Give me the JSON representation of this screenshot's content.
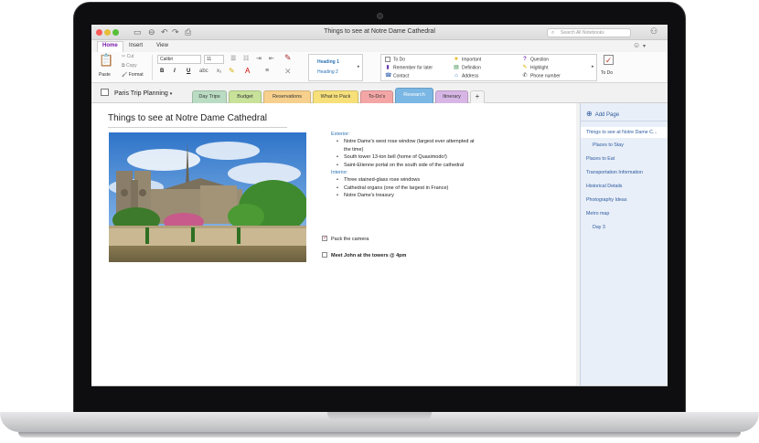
{
  "window": {
    "title": "Things to see at Notre Dame Cathedral",
    "search_placeholder": "Search All Notebooks"
  },
  "ribbon_tabs": [
    "Home",
    "Insert",
    "View"
  ],
  "ribbon": {
    "paste": "Paste",
    "cut": "Cut",
    "copy": "Copy",
    "format": "Format",
    "font": "Calibri",
    "size": "11",
    "bold": "B",
    "italic": "I",
    "underline": "U",
    "styles": [
      "Heading 1",
      "Heading 2"
    ],
    "tags": {
      "col1": [
        "To Do",
        "Remember for later",
        "Contact"
      ],
      "col2": [
        "Important",
        "Definition",
        "Address"
      ],
      "col3": [
        "Question",
        "Highlight",
        "Phone number"
      ]
    },
    "todo_button": "To Do"
  },
  "notebook": {
    "name": "Paris Trip Planning",
    "sections": [
      {
        "label": "Day Trips",
        "color": "#b9dcc3"
      },
      {
        "label": "Budget",
        "color": "#c8e29a"
      },
      {
        "label": "Reservations",
        "color": "#f6d08c"
      },
      {
        "label": "What to Pack",
        "color": "#f7e07a"
      },
      {
        "label": "To-Do's",
        "color": "#f4a6a6"
      },
      {
        "label": "Research",
        "color": "#7bb7e4"
      },
      {
        "label": "Itinerary",
        "color": "#d7b6e6"
      },
      {
        "label": "+",
        "color": "#f4f4f4"
      }
    ]
  },
  "page": {
    "title": "Things to see at Notre Dame Cathedral",
    "exterior_heading": "Exterior:",
    "exterior_items": [
      "Notre Dame's west rose window (largest ever attempted at",
      "the time)",
      "South tower 13-ton bell (home of Quasimodo!)",
      "Saint-Etienne portal on the south side of the cathedral"
    ],
    "interior_heading": "Interior:",
    "interior_items": [
      "Three stained-glass rose windows",
      "Cathedral organs (one of the largest in France)",
      "Notre Dame's treasury"
    ],
    "todo1": "Pack the camera",
    "todo2": "Meet John at the towers @ 4pm"
  },
  "pages": {
    "add_page": "Add Page",
    "items": [
      "Things to see at Notre Dame C...",
      "Places to Stay",
      "Places to Eat",
      "Transportation Information",
      "Historical Details",
      "Photography Ideas",
      "Metro map",
      "Day 3"
    ]
  }
}
